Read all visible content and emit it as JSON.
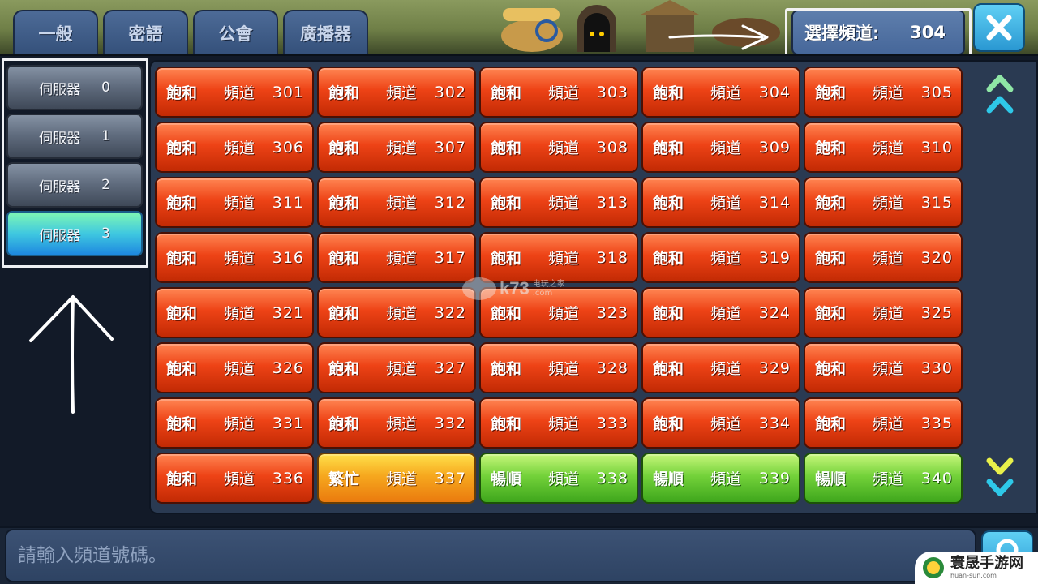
{
  "tabs": [
    {
      "label": "一般"
    },
    {
      "label": "密語"
    },
    {
      "label": "公會"
    },
    {
      "label": "廣播器"
    }
  ],
  "selected_channel": {
    "label": "選擇頻道:",
    "value": "304"
  },
  "servers": [
    {
      "label": "伺服器",
      "number": "0",
      "active": false
    },
    {
      "label": "伺服器",
      "number": "1",
      "active": false
    },
    {
      "label": "伺服器",
      "number": "2",
      "active": false
    },
    {
      "label": "伺服器",
      "number": "3",
      "active": true
    }
  ],
  "channel_word": "頻道",
  "channels": [
    {
      "status": "飽和",
      "number": "301",
      "state": "full"
    },
    {
      "status": "飽和",
      "number": "302",
      "state": "full"
    },
    {
      "status": "飽和",
      "number": "303",
      "state": "full"
    },
    {
      "status": "飽和",
      "number": "304",
      "state": "full"
    },
    {
      "status": "飽和",
      "number": "305",
      "state": "full"
    },
    {
      "status": "飽和",
      "number": "306",
      "state": "full"
    },
    {
      "status": "飽和",
      "number": "307",
      "state": "full"
    },
    {
      "status": "飽和",
      "number": "308",
      "state": "full"
    },
    {
      "status": "飽和",
      "number": "309",
      "state": "full"
    },
    {
      "status": "飽和",
      "number": "310",
      "state": "full"
    },
    {
      "status": "飽和",
      "number": "311",
      "state": "full"
    },
    {
      "status": "飽和",
      "number": "312",
      "state": "full"
    },
    {
      "status": "飽和",
      "number": "313",
      "state": "full"
    },
    {
      "status": "飽和",
      "number": "314",
      "state": "full"
    },
    {
      "status": "飽和",
      "number": "315",
      "state": "full"
    },
    {
      "status": "飽和",
      "number": "316",
      "state": "full"
    },
    {
      "status": "飽和",
      "number": "317",
      "state": "full"
    },
    {
      "status": "飽和",
      "number": "318",
      "state": "full"
    },
    {
      "status": "飽和",
      "number": "319",
      "state": "full"
    },
    {
      "status": "飽和",
      "number": "320",
      "state": "full"
    },
    {
      "status": "飽和",
      "number": "321",
      "state": "full"
    },
    {
      "status": "飽和",
      "number": "322",
      "state": "full"
    },
    {
      "status": "飽和",
      "number": "323",
      "state": "full"
    },
    {
      "status": "飽和",
      "number": "324",
      "state": "full"
    },
    {
      "status": "飽和",
      "number": "325",
      "state": "full"
    },
    {
      "status": "飽和",
      "number": "326",
      "state": "full"
    },
    {
      "status": "飽和",
      "number": "327",
      "state": "full"
    },
    {
      "status": "飽和",
      "number": "328",
      "state": "full"
    },
    {
      "status": "飽和",
      "number": "329",
      "state": "full"
    },
    {
      "status": "飽和",
      "number": "330",
      "state": "full"
    },
    {
      "status": "飽和",
      "number": "331",
      "state": "full"
    },
    {
      "status": "飽和",
      "number": "332",
      "state": "full"
    },
    {
      "status": "飽和",
      "number": "333",
      "state": "full"
    },
    {
      "status": "飽和",
      "number": "334",
      "state": "full"
    },
    {
      "status": "飽和",
      "number": "335",
      "state": "full"
    },
    {
      "status": "飽和",
      "number": "336",
      "state": "full"
    },
    {
      "status": "繁忙",
      "number": "337",
      "state": "busy"
    },
    {
      "status": "暢順",
      "number": "338",
      "state": "smooth"
    },
    {
      "status": "暢順",
      "number": "339",
      "state": "smooth"
    },
    {
      "status": "暢順",
      "number": "340",
      "state": "smooth"
    }
  ],
  "input": {
    "placeholder": "請輸入頻道號碼。",
    "value": ""
  },
  "watermark": {
    "text": "k73",
    "sub": "电玩之家",
    "domain": ".com"
  },
  "site_logo": {
    "text": "寰晟手游网",
    "url": "huan-sun.com"
  },
  "colors": {
    "full": "#e2400f",
    "busy": "#f5a31c",
    "smooth": "#6ccb36",
    "server_active": "#3fc8e0",
    "tab": "#4060a0"
  },
  "icons": {
    "close": "close-x-icon",
    "search": "magnifier-icon",
    "scroll_up": "double-chevron-up-icon",
    "scroll_down": "double-chevron-down-icon"
  }
}
